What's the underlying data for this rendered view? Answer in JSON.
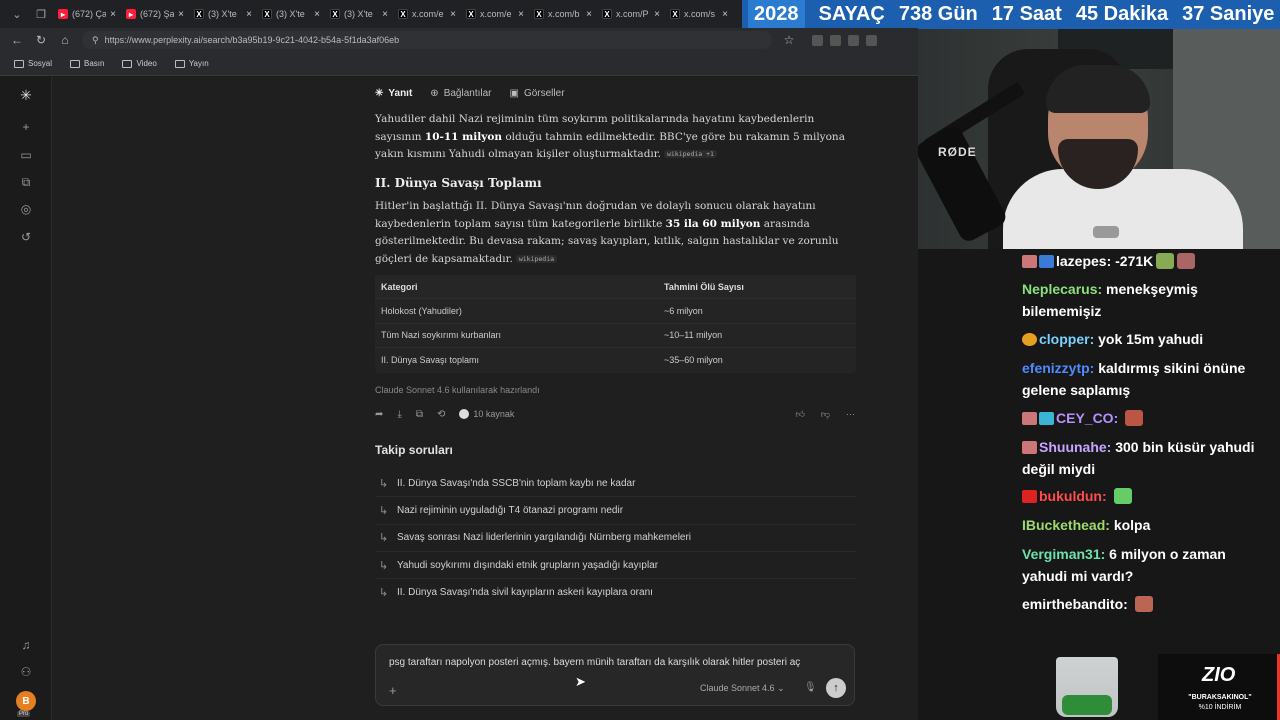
{
  "tabs": [
    {
      "label": "(672) Ça",
      "icon": "youtube-icon"
    },
    {
      "label": "(672) Şa",
      "icon": "youtube-icon"
    },
    {
      "label": "(3) X'te",
      "icon": "x-icon"
    },
    {
      "label": "(3) X'te",
      "icon": "x-icon"
    },
    {
      "label": "(3) X'te",
      "icon": "x-icon"
    },
    {
      "label": "x.com/e",
      "icon": "x-icon"
    },
    {
      "label": "x.com/e",
      "icon": "x-icon"
    },
    {
      "label": "x.com/b",
      "icon": "x-icon"
    },
    {
      "label": "x.com/P",
      "icon": "x-icon"
    },
    {
      "label": "x.com/s",
      "icon": "x-icon"
    }
  ],
  "banner": {
    "year": "2028",
    "label": "SAYAÇ",
    "days": "738 Gün",
    "hours": "17 Saat",
    "minutes": "45 Dakika",
    "seconds": "37 Saniye"
  },
  "address": {
    "url": "https://www.perplexity.ai/search/b3a95b19-9c21-4042-b54a-5f1da3af06eb"
  },
  "bookmarks": [
    "Sosyal",
    "Basın",
    "Video",
    "Yayın"
  ],
  "nav": {
    "answer": "Yanıt",
    "links": "Bağlantılar",
    "images": "Görseller"
  },
  "answer": {
    "p1_a": "Yahudiler dahil Nazi rejiminin tüm soykırım politikalarında hayatını kaybedenlerin sayısının ",
    "p1_b": "10-11 milyon",
    "p1_c": " olduğu tahmin edilmektedir. BBC'ye göre bu rakamın 5 milyona yakın kısmını Yahudi olmayan kişiler oluşturmaktadır.",
    "cite1": "wikipedia +1",
    "heading": "II. Dünya Savaşı Toplamı",
    "p2_a": "Hitler'in başlattığı II. Dünya Savaşı'nın doğrudan ve dolaylı sonucu olarak hayatını kaybedenlerin toplam sayısı tüm kategorilerle birlikte ",
    "p2_b": "35 ila 60 milyon",
    "p2_c": " arasında gösterilmektedir. Bu devasa rakam; savaş kayıpları, kıtlık, salgın hastalıklar ve zorunlu göçleri de kapsamaktadır.",
    "cite2": "wikipedia"
  },
  "table": {
    "headers": [
      "Kategori",
      "Tahmini Ölü Sayısı"
    ],
    "rows": [
      [
        "Holokost (Yahudiler)",
        "~6 milyon"
      ],
      [
        "Tüm Nazi soykırımı kurbanları",
        "~10–11 milyon"
      ],
      [
        "II. Dünya Savaşı toplamı",
        "~35–60 milyon"
      ]
    ]
  },
  "model_note": "Claude Sonnet 4.6 kullanılarak hazırlandı",
  "sources_label": "10 kaynak",
  "followups_title": "Takip soruları",
  "followups": [
    "II. Dünya Savaşı'nda SSCB'nin toplam kaybı ne kadar",
    "Nazi rejiminin uyguladığı T4 ötanazi programı nedir",
    "Savaş sonrası Nazi liderlerinin yargılandığı Nürnberg mahkemeleri",
    "Yahudi soykırımı dışındaki etnik grupların yaşadığı kayıplar",
    "II. Dünya Savaşı'nda sivil kayıpların askeri kayıplara oranı"
  ],
  "input": {
    "value": "psg taraftarı napolyon posteri açmış. bayern münih taraftarı da karşılık olarak hitler posteri aç",
    "model": "Claude Sonnet 4.6"
  },
  "cam": {
    "mic_brand": "RØDE"
  },
  "chat": [
    {
      "user": "lazepes:",
      "text": "-271K",
      "color": "#ffffff"
    },
    {
      "user": "Neplecarus:",
      "text": "menekşeymiş bilememişiz",
      "color": "#8be07b"
    },
    {
      "user": "clopper:",
      "text": "yok 15m yahudi",
      "color": "#7ad0ff"
    },
    {
      "user": "efenizzytp:",
      "text": "kaldırmış sikini önüne gelene saplamış",
      "color": "#4f8bff"
    },
    {
      "user": "CEY_CO:",
      "text": "",
      "color": "#b690ff"
    },
    {
      "user": "Shuunahe:",
      "text": "300 bin küsür yahudi değil miydi",
      "color": "#c8a5ff"
    },
    {
      "user": "bukuldun:",
      "text": "",
      "color": "#ff4d4d"
    },
    {
      "user": "IBuckethead:",
      "text": "kolpa",
      "color": "#9fd86b"
    },
    {
      "user": "Vergiman31:",
      "text": "6 milyon o zaman yahudi mi vardı?",
      "color": "#6fe1a8"
    },
    {
      "user": "emirthebandito:",
      "text": "",
      "color": "#ffffff"
    }
  ],
  "ad": {
    "brand": "ZIO",
    "line1": "\"BURAKSAKINOL\"",
    "line2": "%10 İNDİRİM"
  }
}
